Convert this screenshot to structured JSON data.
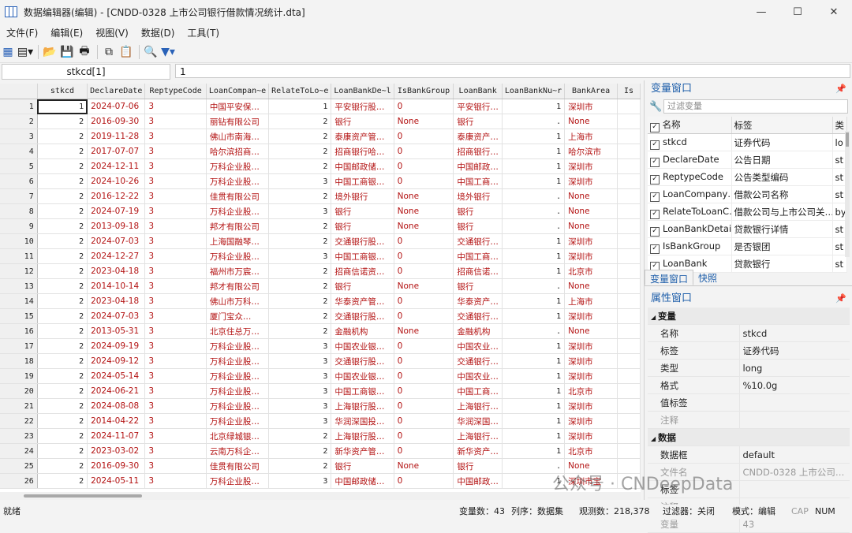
{
  "window": {
    "title": "数据编辑器(编辑) - [CNDD-0328 上市公司银行借款情况统计.dta]"
  },
  "menu": [
    "文件(F)",
    "编辑(E)",
    "视图(V)",
    "数据(D)",
    "工具(T)"
  ],
  "formula": {
    "varname": "stkcd[1]",
    "value": "1"
  },
  "grid": {
    "headers": [
      "stkcd",
      "DeclareDate",
      "ReptypeCode",
      "LoanCompan~e",
      "RelateToLo~e",
      "LoanBankDe~l",
      "IsBankGroup",
      "LoanBank",
      "LoanBankNu~r",
      "BankArea",
      "Is"
    ],
    "rows": [
      [
        "1",
        "2024-07-06",
        "3",
        "中国平安保…",
        "1",
        "平安银行股…",
        "0",
        "平安银行…",
        "1",
        "深圳市",
        ""
      ],
      [
        "2",
        "2016-09-30",
        "3",
        "丽钻有限公司",
        "2",
        "银行",
        "None",
        "银行",
        ".",
        "None",
        ""
      ],
      [
        "2",
        "2019-11-28",
        "3",
        "佛山市南海…",
        "2",
        "泰康资产管…",
        "0",
        "泰康资产…",
        "1",
        "上海市",
        ""
      ],
      [
        "2",
        "2017-07-07",
        "3",
        "哈尔滨招商…",
        "2",
        "招商银行哈…",
        "0",
        "招商银行…",
        "1",
        "哈尔滨市",
        ""
      ],
      [
        "2",
        "2024-12-11",
        "3",
        "万科企业股…",
        "2",
        "中国邮政储…",
        "0",
        "中国邮政…",
        "1",
        "深圳市",
        ""
      ],
      [
        "2",
        "2024-10-26",
        "3",
        "万科企业股…",
        "3",
        "中国工商银…",
        "0",
        "中国工商…",
        "1",
        "深圳市",
        ""
      ],
      [
        "2",
        "2016-12-22",
        "3",
        "佳贯有限公司",
        "2",
        "境外银行",
        "None",
        "境外银行",
        ".",
        "None",
        ""
      ],
      [
        "2",
        "2024-07-19",
        "3",
        "万科企业股…",
        "3",
        "银行",
        "None",
        "银行",
        ".",
        "None",
        ""
      ],
      [
        "2",
        "2013-09-18",
        "3",
        "邦才有限公司",
        "2",
        "银行",
        "None",
        "银行",
        ".",
        "None",
        ""
      ],
      [
        "2",
        "2024-07-03",
        "3",
        "上海国融琴…",
        "2",
        "交通银行股…",
        "0",
        "交通银行…",
        "1",
        "深圳市",
        ""
      ],
      [
        "2",
        "2024-12-27",
        "3",
        "万科企业股…",
        "3",
        "中国工商银…",
        "0",
        "中国工商…",
        "1",
        "深圳市",
        ""
      ],
      [
        "2",
        "2023-04-18",
        "3",
        "福州市万宸…",
        "2",
        "招商信诺资…",
        "0",
        "招商信诺…",
        "1",
        "北京市",
        ""
      ],
      [
        "2",
        "2014-10-14",
        "3",
        "邦才有限公司",
        "2",
        "银行",
        "None",
        "银行",
        ".",
        "None",
        ""
      ],
      [
        "2",
        "2023-04-18",
        "3",
        "佛山市万科…",
        "2",
        "华泰资产管…",
        "0",
        "华泰资产…",
        "1",
        "上海市",
        ""
      ],
      [
        "2",
        "2024-07-03",
        "3",
        "厦门宝众…",
        "2",
        "交通银行股…",
        "0",
        "交通银行…",
        "1",
        "深圳市",
        ""
      ],
      [
        "2",
        "2013-05-31",
        "3",
        "北京住总万…",
        "2",
        "金融机构",
        "None",
        "金融机构",
        ".",
        "None",
        ""
      ],
      [
        "2",
        "2024-09-19",
        "3",
        "万科企业股…",
        "3",
        "中国农业银…",
        "0",
        "中国农业…",
        "1",
        "深圳市",
        ""
      ],
      [
        "2",
        "2024-09-12",
        "3",
        "万科企业股…",
        "3",
        "交通银行股…",
        "0",
        "交通银行…",
        "1",
        "深圳市",
        ""
      ],
      [
        "2",
        "2024-05-14",
        "3",
        "万科企业股…",
        "3",
        "中国农业银…",
        "0",
        "中国农业…",
        "1",
        "深圳市",
        ""
      ],
      [
        "2",
        "2024-06-21",
        "3",
        "万科企业股…",
        "3",
        "中国工商银…",
        "0",
        "中国工商…",
        "1",
        "北京市",
        ""
      ],
      [
        "2",
        "2024-08-08",
        "3",
        "万科企业股…",
        "3",
        "上海银行股…",
        "0",
        "上海银行…",
        "1",
        "深圳市",
        ""
      ],
      [
        "2",
        "2014-04-22",
        "3",
        "万科企业股…",
        "3",
        "华润深国投…",
        "0",
        "华润深国…",
        "1",
        "深圳市",
        ""
      ],
      [
        "2",
        "2024-11-07",
        "3",
        "北京绿城银…",
        "2",
        "上海银行股…",
        "0",
        "上海银行…",
        "1",
        "深圳市",
        ""
      ],
      [
        "2",
        "2023-03-02",
        "3",
        "云南万科企…",
        "2",
        "新华资产管…",
        "0",
        "新华资产…",
        "1",
        "北京市",
        ""
      ],
      [
        "2",
        "2016-09-30",
        "3",
        "佳贯有限公司",
        "2",
        "银行",
        "None",
        "银行",
        ".",
        "None",
        ""
      ],
      [
        "2",
        "2024-05-11",
        "3",
        "万科企业股…",
        "3",
        "中国邮政储…",
        "0",
        "中国邮政…",
        "1",
        "深圳市宝",
        ""
      ]
    ]
  },
  "var_window": {
    "title": "变量窗口",
    "filter_placeholder": "过滤变量",
    "col_name": "名称",
    "col_label": "标签",
    "col_third": "类",
    "vars": [
      {
        "name": "stkcd",
        "label": "证券代码",
        "t": "lo"
      },
      {
        "name": "DeclareDate",
        "label": "公告日期",
        "t": "st"
      },
      {
        "name": "ReptypeCode",
        "label": "公告类型编码",
        "t": "st"
      },
      {
        "name": "LoanCompany…",
        "label": "借款公司名称",
        "t": "st"
      },
      {
        "name": "RelateToLoanC…",
        "label": "借款公司与上市公司关…",
        "t": "by"
      },
      {
        "name": "LoanBankDetail",
        "label": "贷款银行详情",
        "t": "st"
      },
      {
        "name": "IsBankGroup",
        "label": "是否银团",
        "t": "st"
      },
      {
        "name": "LoanBank",
        "label": "贷款银行",
        "t": "st"
      }
    ]
  },
  "tabs": [
    "变量窗口",
    "快照"
  ],
  "props": {
    "title": "属性窗口",
    "sec_var": "变量",
    "sec_data": "数据",
    "var_rows": [
      {
        "k": "名称",
        "v": "stkcd"
      },
      {
        "k": "标签",
        "v": "证券代码"
      },
      {
        "k": "类型",
        "v": "long"
      },
      {
        "k": "格式",
        "v": "%10.0g"
      },
      {
        "k": "值标签",
        "v": ""
      },
      {
        "k": "注释",
        "v": ""
      }
    ],
    "data_rows": [
      {
        "k": "数据框",
        "v": "default"
      },
      {
        "k": "文件名",
        "v": "CNDD-0328 上市公司…"
      },
      {
        "k": "标签",
        "v": ""
      },
      {
        "k": "注释",
        "v": ""
      },
      {
        "k": "变量",
        "v": "43"
      }
    ]
  },
  "status": {
    "ready": "就绪",
    "var_count": "变量数：43",
    "order": "列序：数据集",
    "obs": "观测数：218,378",
    "filter": "过滤器：关闭",
    "mode": "模式：编辑",
    "cap": "CAP",
    "num": "NUM"
  },
  "watermark": "公众号 · CNDeepData"
}
